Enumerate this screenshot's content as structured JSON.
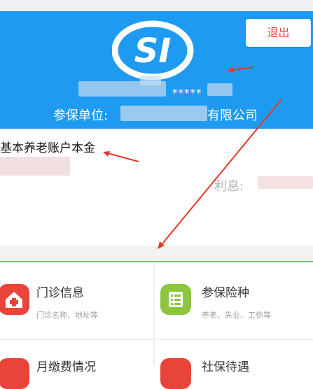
{
  "header": {
    "logo_text": "SI",
    "logout_label": "退出",
    "masked_name": "*****",
    "unit_label": "参保单位:",
    "unit_suffix": "有限公司"
  },
  "account": {
    "title": "基本养老账户本金",
    "interest_label": "利息:"
  },
  "grid": {
    "items": [
      {
        "title": "门诊信息",
        "subtitle": "门诊名称、地址等",
        "icon": "clinic-house-icon",
        "color": "#e8443a"
      },
      {
        "title": "参保险种",
        "subtitle": "养老、失业、工伤等",
        "icon": "list-icon",
        "color": "#8cc63f"
      },
      {
        "title": "月缴费情况",
        "subtitle": "",
        "icon": "payment-icon",
        "color": "#e8443a"
      },
      {
        "title": "社保待遇",
        "subtitle": "",
        "icon": "benefit-icon",
        "color": "#e8443a"
      }
    ]
  },
  "colors": {
    "header_bg": "#1e9bf0",
    "accent_red": "#e8443a",
    "accent_green": "#8cc63f"
  }
}
